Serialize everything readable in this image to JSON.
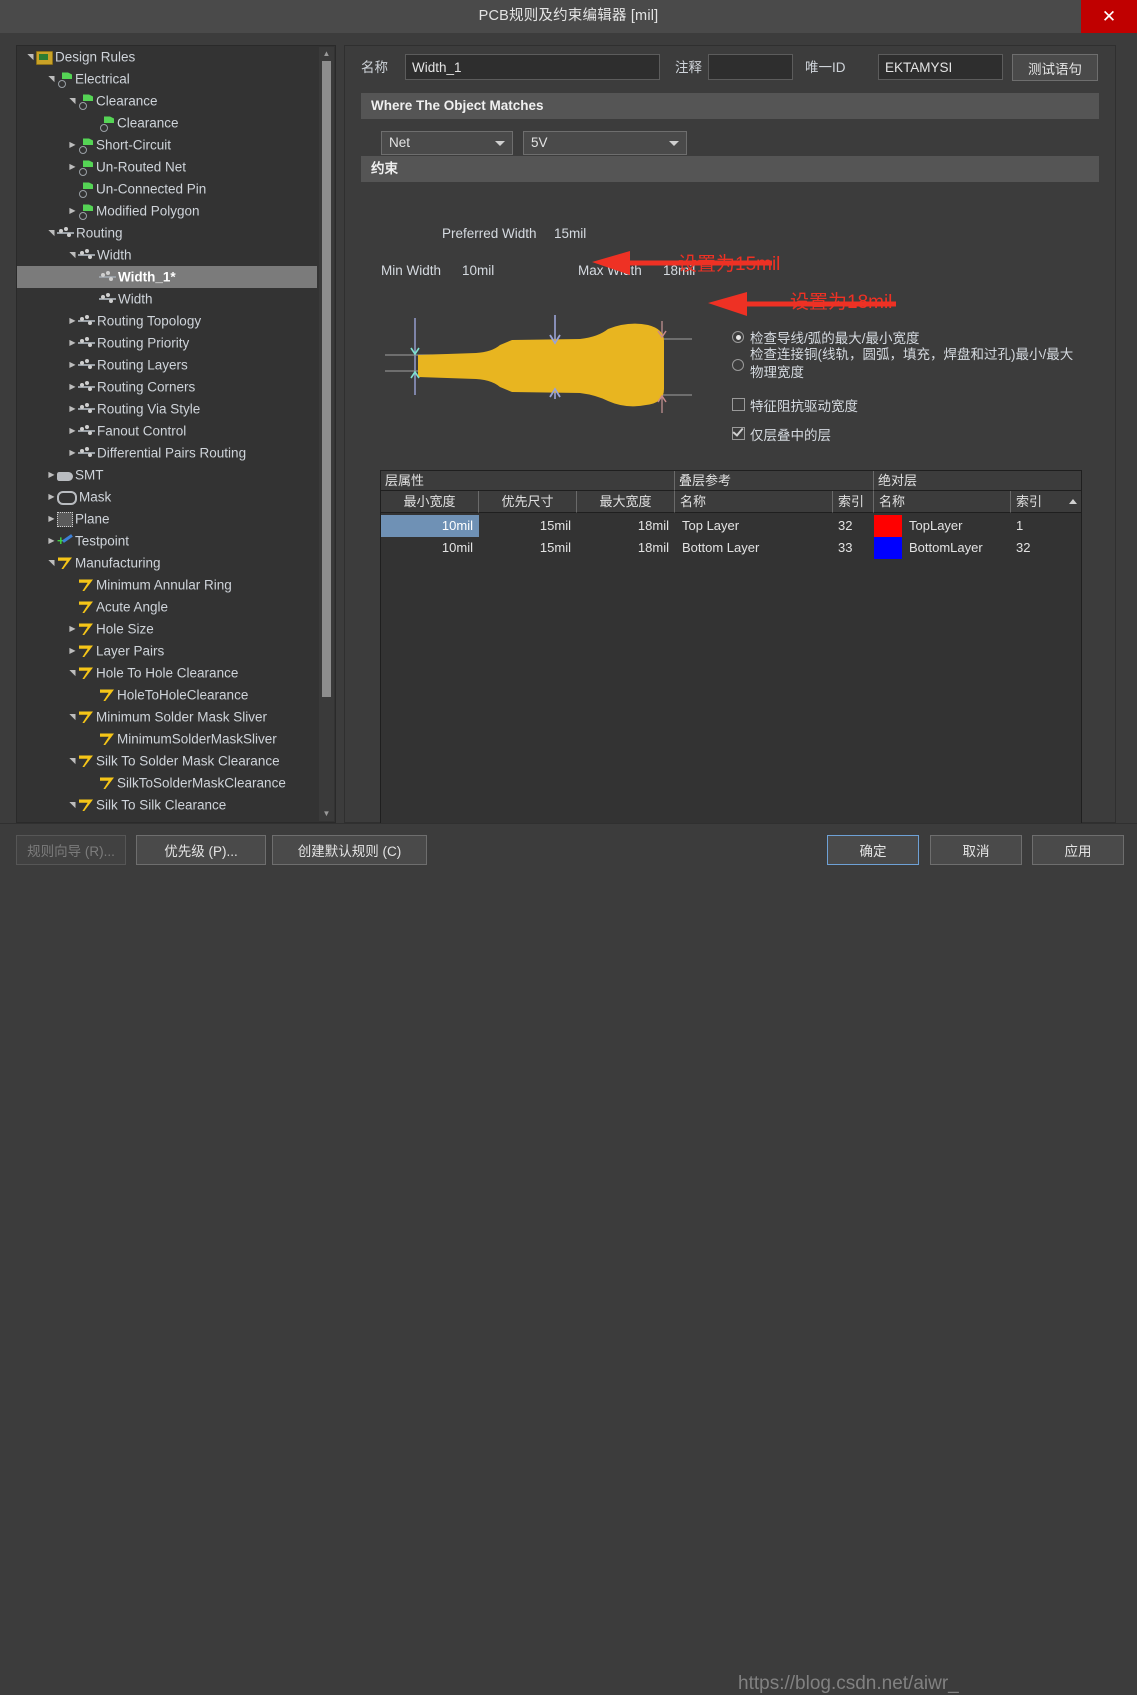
{
  "window": {
    "title": "PCB规则及约束编辑器 [mil]",
    "close_label": "✕"
  },
  "tree": {
    "items": [
      {
        "label": "Design Rules",
        "depth": 0,
        "arrow": "down",
        "icon": "folder-icon",
        "selected": false
      },
      {
        "label": "Electrical",
        "depth": 1,
        "arrow": "down",
        "icon": "electrical-icon",
        "selected": false
      },
      {
        "label": "Clearance",
        "depth": 2,
        "arrow": "down",
        "icon": "electrical-icon",
        "selected": false
      },
      {
        "label": "Clearance",
        "depth": 3,
        "arrow": "none",
        "icon": "electrical-icon",
        "selected": false
      },
      {
        "label": "Short-Circuit",
        "depth": 2,
        "arrow": "right",
        "icon": "electrical-icon",
        "selected": false
      },
      {
        "label": "Un-Routed Net",
        "depth": 2,
        "arrow": "right",
        "icon": "electrical-icon",
        "selected": false
      },
      {
        "label": "Un-Connected Pin",
        "depth": 2,
        "arrow": "none",
        "icon": "electrical-icon",
        "selected": false
      },
      {
        "label": "Modified Polygon",
        "depth": 2,
        "arrow": "right",
        "icon": "electrical-icon",
        "selected": false
      },
      {
        "label": "Routing",
        "depth": 1,
        "arrow": "down",
        "icon": "routing-icon",
        "selected": false
      },
      {
        "label": "Width",
        "depth": 2,
        "arrow": "down",
        "icon": "routing-icon",
        "selected": false
      },
      {
        "label": "Width_1*",
        "depth": 3,
        "arrow": "none",
        "icon": "routing-icon",
        "selected": true
      },
      {
        "label": "Width",
        "depth": 3,
        "arrow": "none",
        "icon": "routing-icon",
        "selected": false
      },
      {
        "label": "Routing Topology",
        "depth": 2,
        "arrow": "right",
        "icon": "routing-icon",
        "selected": false
      },
      {
        "label": "Routing Priority",
        "depth": 2,
        "arrow": "right",
        "icon": "routing-icon",
        "selected": false
      },
      {
        "label": "Routing Layers",
        "depth": 2,
        "arrow": "right",
        "icon": "routing-icon",
        "selected": false
      },
      {
        "label": "Routing Corners",
        "depth": 2,
        "arrow": "right",
        "icon": "routing-icon",
        "selected": false
      },
      {
        "label": "Routing Via Style",
        "depth": 2,
        "arrow": "right",
        "icon": "routing-icon",
        "selected": false
      },
      {
        "label": "Fanout Control",
        "depth": 2,
        "arrow": "right",
        "icon": "routing-icon",
        "selected": false
      },
      {
        "label": "Differential Pairs Routing",
        "depth": 2,
        "arrow": "right",
        "icon": "routing-icon",
        "selected": false
      },
      {
        "label": "SMT",
        "depth": 1,
        "arrow": "right",
        "icon": "smt-icon",
        "selected": false
      },
      {
        "label": "Mask",
        "depth": 1,
        "arrow": "right",
        "icon": "mask-icon",
        "selected": false
      },
      {
        "label": "Plane",
        "depth": 1,
        "arrow": "right",
        "icon": "plane-icon",
        "selected": false
      },
      {
        "label": "Testpoint",
        "depth": 1,
        "arrow": "right",
        "icon": "testpoint-icon",
        "selected": false
      },
      {
        "label": "Manufacturing",
        "depth": 1,
        "arrow": "down",
        "icon": "manufacturing-icon",
        "selected": false
      },
      {
        "label": "Minimum Annular Ring",
        "depth": 2,
        "arrow": "none",
        "icon": "manufacturing-icon",
        "selected": false
      },
      {
        "label": "Acute Angle",
        "depth": 2,
        "arrow": "none",
        "icon": "manufacturing-icon",
        "selected": false
      },
      {
        "label": "Hole Size",
        "depth": 2,
        "arrow": "right",
        "icon": "manufacturing-icon",
        "selected": false
      },
      {
        "label": "Layer Pairs",
        "depth": 2,
        "arrow": "right",
        "icon": "manufacturing-icon",
        "selected": false
      },
      {
        "label": "Hole To Hole Clearance",
        "depth": 2,
        "arrow": "down",
        "icon": "manufacturing-icon",
        "selected": false
      },
      {
        "label": "HoleToHoleClearance",
        "depth": 3,
        "arrow": "none",
        "icon": "manufacturing-icon",
        "selected": false
      },
      {
        "label": "Minimum Solder Mask Sliver",
        "depth": 2,
        "arrow": "down",
        "icon": "manufacturing-icon",
        "selected": false
      },
      {
        "label": "MinimumSolderMaskSliver",
        "depth": 3,
        "arrow": "none",
        "icon": "manufacturing-icon",
        "selected": false
      },
      {
        "label": "Silk To Solder Mask Clearance",
        "depth": 2,
        "arrow": "down",
        "icon": "manufacturing-icon",
        "selected": false
      },
      {
        "label": "SilkToSolderMaskClearance",
        "depth": 3,
        "arrow": "none",
        "icon": "manufacturing-icon",
        "selected": false
      },
      {
        "label": "Silk To Silk Clearance",
        "depth": 2,
        "arrow": "down",
        "icon": "manufacturing-icon",
        "selected": false
      }
    ]
  },
  "form": {
    "name_label": "名称",
    "name_value": "Width_1",
    "comment_label": "注释",
    "comment_value": "",
    "uniqueid_label": "唯一ID",
    "uniqueid_value": "EKTAMYSI",
    "test_query_label": "测试语句"
  },
  "where": {
    "header": "Where The Object Matches",
    "scope_value": "Net",
    "net_value": "5V"
  },
  "constraint": {
    "header": "约束",
    "preferred_width_label": "Preferred Width",
    "preferred_width_value": "15mil",
    "min_width_label": "Min Width",
    "min_width_value": "10mil",
    "max_width_label": "Max Width",
    "max_width_value": "18mil",
    "options": [
      {
        "type": "radio",
        "checked": true,
        "label": "检查导线/弧的最大/最小宽度"
      },
      {
        "type": "radio",
        "checked": false,
        "label": "检查连接铜(线轨，圆弧，填充，焊盘和过孔)最小/最大",
        "label2": "物理宽度"
      },
      {
        "type": "checkbox",
        "checked": false,
        "label": "特征阻抗驱动宽度"
      },
      {
        "type": "checkbox",
        "checked": true,
        "label": "仅层叠中的层"
      }
    ]
  },
  "annotations": [
    {
      "text": "设置为15mil",
      "color": "#ee3124"
    },
    {
      "text": "设置为18mil",
      "color": "#ee3124"
    }
  ],
  "table": {
    "groups": [
      {
        "label": "层属性"
      },
      {
        "label": "叠层参考"
      },
      {
        "label": "绝对层"
      }
    ],
    "columns": [
      "最小宽度",
      "优先尺寸",
      "最大宽度",
      "名称",
      "索引",
      "名称",
      "索引"
    ],
    "rows": [
      {
        "min_width": "10mil",
        "preferred": "15mil",
        "max_width": "18mil",
        "stack_name": "Top Layer",
        "stack_index": "32",
        "abs_color": "#ff0000",
        "abs_name": "TopLayer",
        "abs_index": "1",
        "selected": true
      },
      {
        "min_width": "10mil",
        "preferred": "15mil",
        "max_width": "18mil",
        "stack_name": "Bottom Layer",
        "stack_index": "33",
        "abs_color": "#0000ff",
        "abs_name": "BottomLayer",
        "abs_index": "32",
        "selected": false
      }
    ]
  },
  "footer": {
    "rule_wizard": "规则向导 (R)...",
    "priority": "优先级 (P)...",
    "create_default": "创建默认规则 (C)",
    "ok": "确定",
    "cancel": "取消",
    "apply": "应用"
  },
  "watermark": {
    "text": "https://blog.csdn.net/aiwr_"
  },
  "colors": {
    "accent_close": "#c00000",
    "selection": "#6f91b5",
    "trace": "#e8b520",
    "annotation": "#ee3124"
  }
}
